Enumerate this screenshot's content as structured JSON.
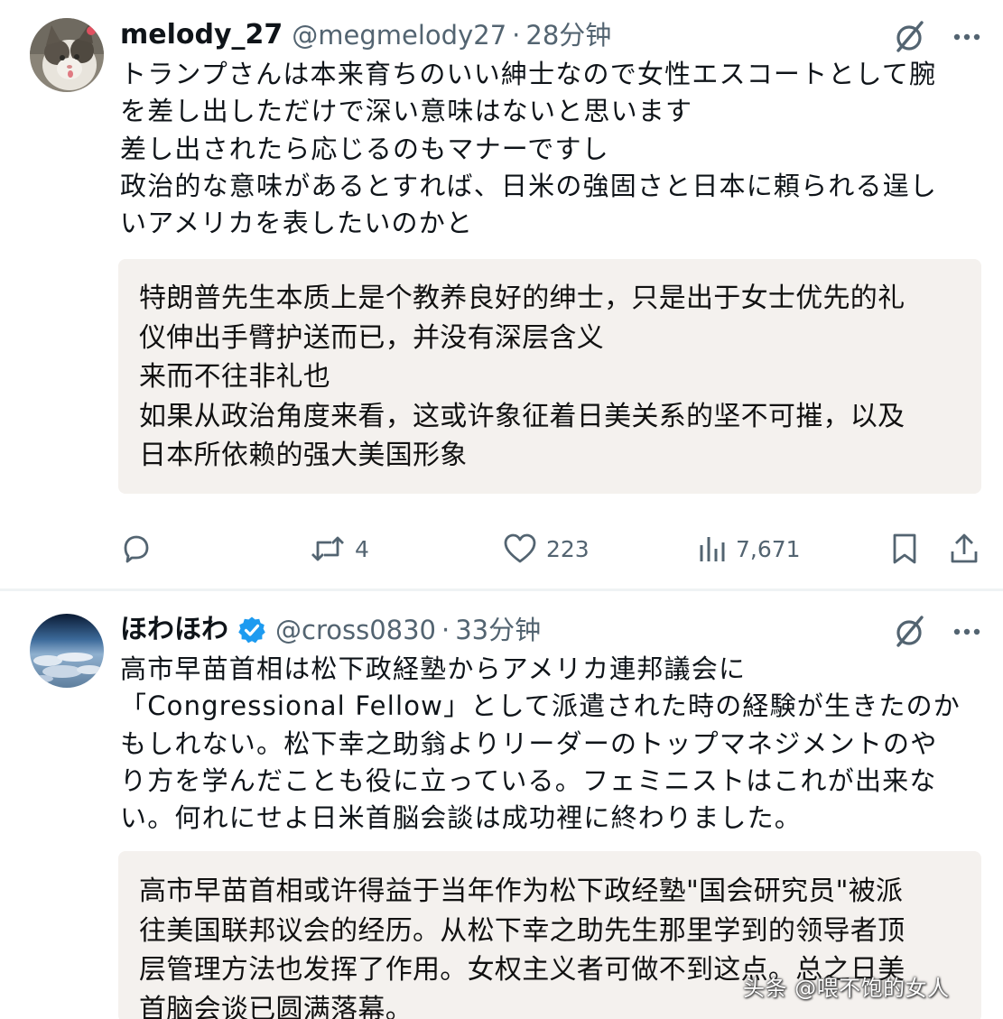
{
  "posts": [
    {
      "display_name": "melody_27",
      "handle": "@megmelody27",
      "separator": "·",
      "time": "28分钟",
      "verified": false,
      "avatar_icon": "cat-avatar",
      "text_lines": [
        "トランプさんは本来育ちのいい紳士なので女性エスコートとして腕",
        "を差し出しただけで深い意味はないと思います",
        "差し出されたら応じるのもマナーですし",
        "政治的な意味があるとすれば、日米の強固さと日本に頼られる逞し",
        "いアメリカを表したいのかと"
      ],
      "translation_lines": [
        "特朗普先生本质上是个教养良好的绅士，只是出于女士优先的礼",
        "仪伸出手臂护送而已，并没有深层含义",
        "来而不往非礼也",
        "如果从政治角度来看，这或许象征着日美关系的坚不可摧，以及",
        "日本所依赖的强大美国形象"
      ],
      "actions": {
        "reply_count": "",
        "repost_count": "4",
        "like_count": "223",
        "views_count": "7,671"
      }
    },
    {
      "display_name": "ほわほわ",
      "handle": "@cross0830",
      "separator": "·",
      "time": "33分钟",
      "verified": true,
      "avatar_icon": "earth-from-space-avatar",
      "text_lines": [
        "高市早苗首相は松下政経塾からアメリカ連邦議会に",
        "「Congressional Fellow」として派遣された時の経験が生きたのか",
        "もしれない。松下幸之助翁よりリーダーのトップマネジメントのや",
        "り方を学んだことも役に立っている。フェミニストはこれが出来な",
        "い。何れにせよ日米首脳会談は成功裡に終わりました。"
      ],
      "translation_lines": [
        "高市早苗首相或许得益于当年作为松下政经塾\"国会研究员\"被派",
        "往美国联邦议会的经历。从松下幸之助先生那里学到的领导者顶",
        "层管理方法也发挥了作用。女权主义者可做不到这点。总之日美",
        "首脑会谈已圆满落幕。"
      ]
    }
  ],
  "watermark": "头条 @喂不饱的女人",
  "colors": {
    "text_primary": "#0f1419",
    "text_secondary": "#536471",
    "translation_bg": "#f4f1ee",
    "verified_blue": "#1d9bf0",
    "divider": "#eff3f4"
  }
}
